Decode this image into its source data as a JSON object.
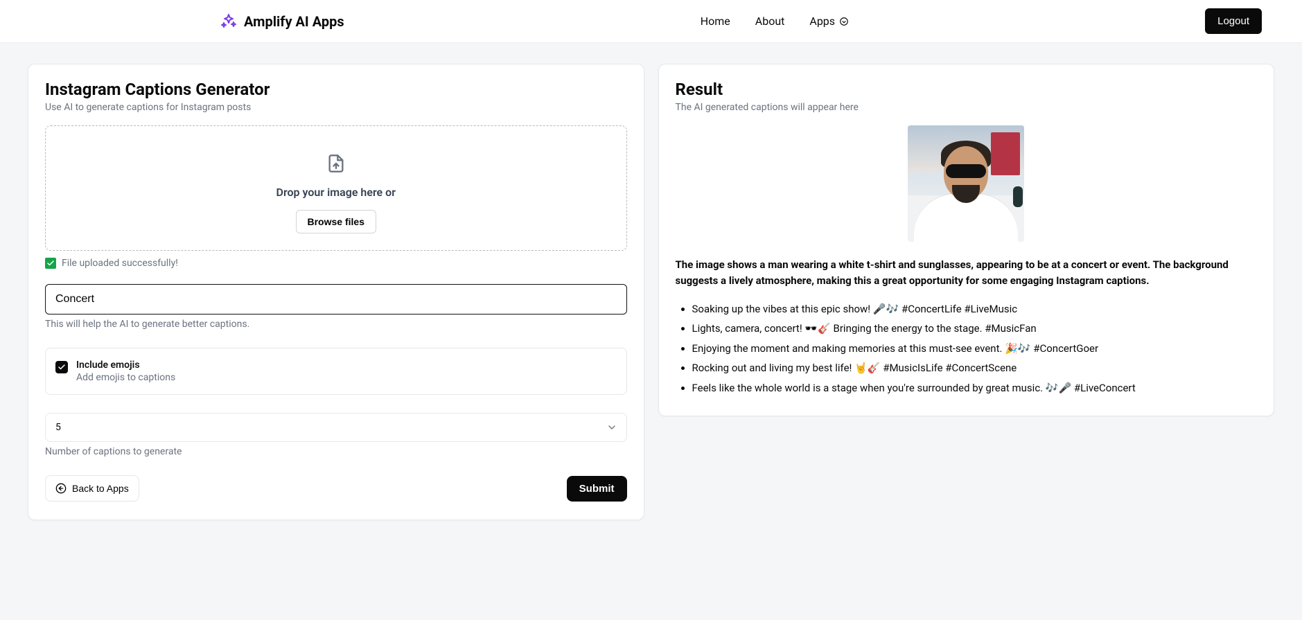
{
  "header": {
    "brand": "Amplify AI Apps",
    "nav": {
      "home": "Home",
      "about": "About",
      "apps": "Apps"
    },
    "logout": "Logout"
  },
  "left": {
    "title": "Instagram Captions Generator",
    "subtitle": "Use AI to generate captions for Instagram posts",
    "dropzone_text": "Drop your image here or",
    "browse_label": "Browse files",
    "upload_status": "File uploaded successfully!",
    "context_value": "Concert",
    "context_help": "This will help the AI to generate better captions.",
    "emoji_label": "Include emojis",
    "emoji_sub": "Add emojis to captions",
    "count_value": "5",
    "count_help": "Number of captions to generate",
    "back_label": "Back to Apps",
    "submit_label": "Submit"
  },
  "right": {
    "title": "Result",
    "subtitle": "The AI generated captions will appear here",
    "description": "The image shows a man wearing a white t-shirt and sunglasses, appearing to be at a concert or event. The background suggests a lively atmosphere, making this a great opportunity for some engaging Instagram captions.",
    "captions": [
      "Soaking up the vibes at this epic show! 🎤🎶 #ConcertLife #LiveMusic",
      "Lights, camera, concert! 🕶️🎸 Bringing the energy to the stage. #MusicFan",
      "Enjoying the moment and making memories at this must-see event. 🎉🎶 #ConcertGoer",
      "Rocking out and living my best life! 🤘🎸 #MusicIsLife #ConcertScene",
      "Feels like the whole world is a stage when you're surrounded by great music. 🎶🎤 #LiveConcert"
    ]
  }
}
